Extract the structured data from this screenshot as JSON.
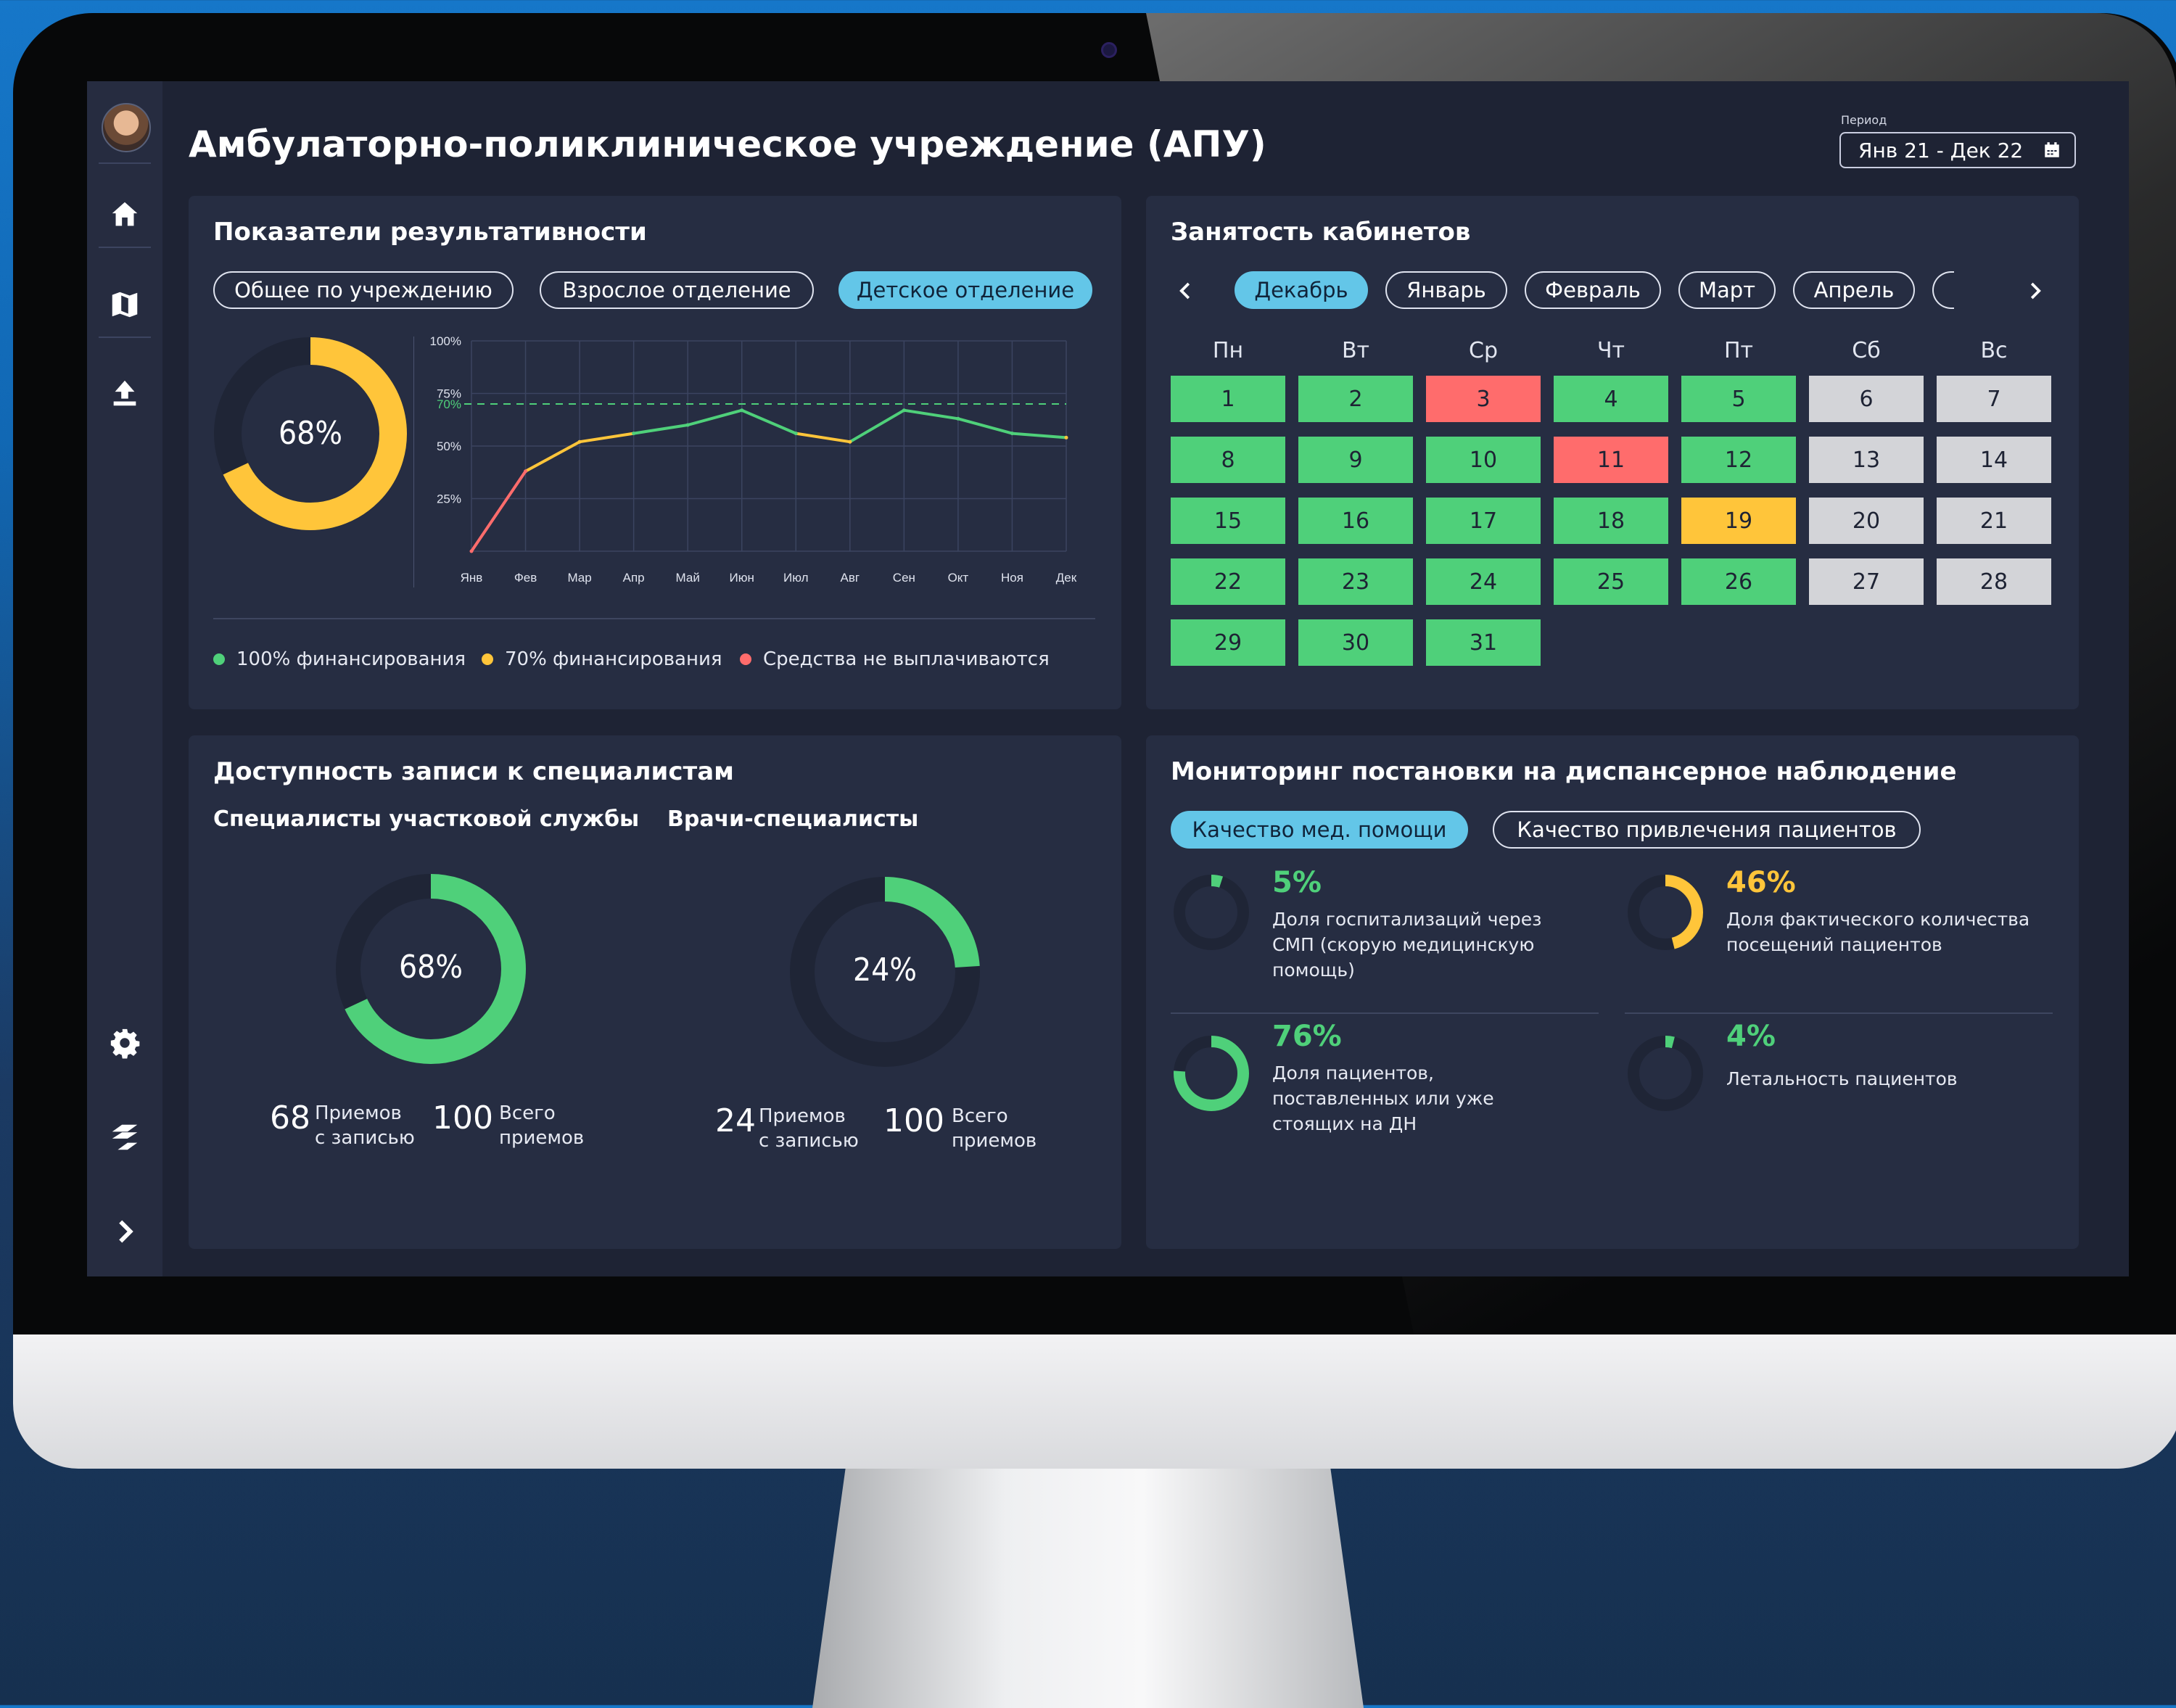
{
  "app": {
    "title": "Амбулаторно-поликлиническое учреждение (АПУ)",
    "period_label": "Период",
    "period_value": "Янв 21 - Дек 22"
  },
  "sidebar": {
    "items": [
      {
        "icon": "home-icon"
      },
      {
        "icon": "map-icon"
      },
      {
        "icon": "upload-icon"
      },
      {
        "icon": "gear-icon"
      },
      {
        "icon": "logo-icon"
      },
      {
        "icon": "chevron-right-icon"
      }
    ]
  },
  "performance": {
    "title": "Показатели результативности",
    "tabs": [
      {
        "label": "Общее по учреждению",
        "active": false
      },
      {
        "label": "Взрослое отделение",
        "active": false
      },
      {
        "label": "Детское отделение",
        "active": true
      }
    ],
    "donut_value": 68,
    "donut_label": "68%",
    "legend": [
      {
        "label": "100% финансирования",
        "color": "#4fd07a"
      },
      {
        "label": "70% финансирования",
        "color": "#ffc53a"
      },
      {
        "label": "Средства не выплачиваются",
        "color": "#ff6c6c"
      }
    ]
  },
  "chart_data": {
    "type": "line",
    "categories": [
      "Янв",
      "Фев",
      "Мар",
      "Апр",
      "Май",
      "Июн",
      "Июл",
      "Авг",
      "Сен",
      "Окт",
      "Ноя",
      "Дек"
    ],
    "series": [
      {
        "values": [
          0,
          38,
          52,
          56,
          60,
          67,
          56,
          52,
          67,
          63,
          56,
          54
        ]
      }
    ],
    "threshold": 70,
    "threshold_label": "70%",
    "yticks": [
      "25%",
      "50%",
      "75%",
      "100%"
    ],
    "ylim": [
      0,
      100
    ],
    "colors": {
      "low": "#ff6c6c",
      "mid": "#ffc53a",
      "high": "#4fd07a"
    }
  },
  "rooms": {
    "title": "Занятость кабинетов",
    "months": [
      {
        "label": "Декабрь",
        "active": true
      },
      {
        "label": "Январь",
        "active": false
      },
      {
        "label": "Февраль",
        "active": false
      },
      {
        "label": "Март",
        "active": false
      },
      {
        "label": "Апрель",
        "active": false
      }
    ],
    "weekdays": [
      "Пн",
      "Вт",
      "Ср",
      "Чт",
      "Пт",
      "Сб",
      "Вс"
    ],
    "days": [
      {
        "d": "1",
        "s": "work"
      },
      {
        "d": "2",
        "s": "work"
      },
      {
        "d": "3",
        "s": "busy"
      },
      {
        "d": "4",
        "s": "work"
      },
      {
        "d": "5",
        "s": "work"
      },
      {
        "d": "6",
        "s": "weekend"
      },
      {
        "d": "7",
        "s": "weekend"
      },
      {
        "d": "8",
        "s": "work"
      },
      {
        "d": "9",
        "s": "work"
      },
      {
        "d": "10",
        "s": "work"
      },
      {
        "d": "11",
        "s": "busy"
      },
      {
        "d": "12",
        "s": "work"
      },
      {
        "d": "13",
        "s": "weekend"
      },
      {
        "d": "14",
        "s": "weekend"
      },
      {
        "d": "15",
        "s": "work"
      },
      {
        "d": "16",
        "s": "work"
      },
      {
        "d": "17",
        "s": "work"
      },
      {
        "d": "18",
        "s": "work"
      },
      {
        "d": "19",
        "s": "partial"
      },
      {
        "d": "20",
        "s": "weekend"
      },
      {
        "d": "21",
        "s": "weekend"
      },
      {
        "d": "22",
        "s": "work"
      },
      {
        "d": "23",
        "s": "work"
      },
      {
        "d": "24",
        "s": "work"
      },
      {
        "d": "25",
        "s": "work"
      },
      {
        "d": "26",
        "s": "work"
      },
      {
        "d": "27",
        "s": "weekend"
      },
      {
        "d": "28",
        "s": "weekend"
      },
      {
        "d": "29",
        "s": "work"
      },
      {
        "d": "30",
        "s": "work"
      },
      {
        "d": "31",
        "s": "work"
      }
    ]
  },
  "availability": {
    "title": "Доступность записи к специалистам",
    "groups": [
      {
        "title": "Специалисты участковой службы",
        "value": 68,
        "label": "68%",
        "booked": "68",
        "booked_label": "Приемов\nс записью",
        "total": "100",
        "total_label": "Всего\nприемов"
      },
      {
        "title": "Врачи-специалисты",
        "value": 24,
        "label": "24%",
        "booked": "24",
        "booked_label": "Приемов\nс записью",
        "total": "100",
        "total_label": "Всего\nприемов"
      }
    ]
  },
  "monitoring": {
    "title": "Мониторинг постановки на диспансерное наблюдение",
    "tabs": [
      {
        "label": "Качество мед. помощи",
        "active": true
      },
      {
        "label": "Качество привлечения пациентов",
        "active": false
      }
    ],
    "metrics": [
      {
        "value": 5,
        "label": "5%",
        "color": "#4fd07a",
        "text": "Доля госпитализаций через СМП (скорую медицинскую помощь)"
      },
      {
        "value": 46,
        "label": "46%",
        "color": "#ffc53a",
        "text": "Доля фактического количества посещений пациентов"
      },
      {
        "value": 76,
        "label": "76%",
        "color": "#4fd07a",
        "text": "Доля пациентов, поставленных или уже стоящих на ДН"
      },
      {
        "value": 4,
        "label": "4%",
        "color": "#4fd07a",
        "text": "Летальность пациентов"
      }
    ]
  }
}
